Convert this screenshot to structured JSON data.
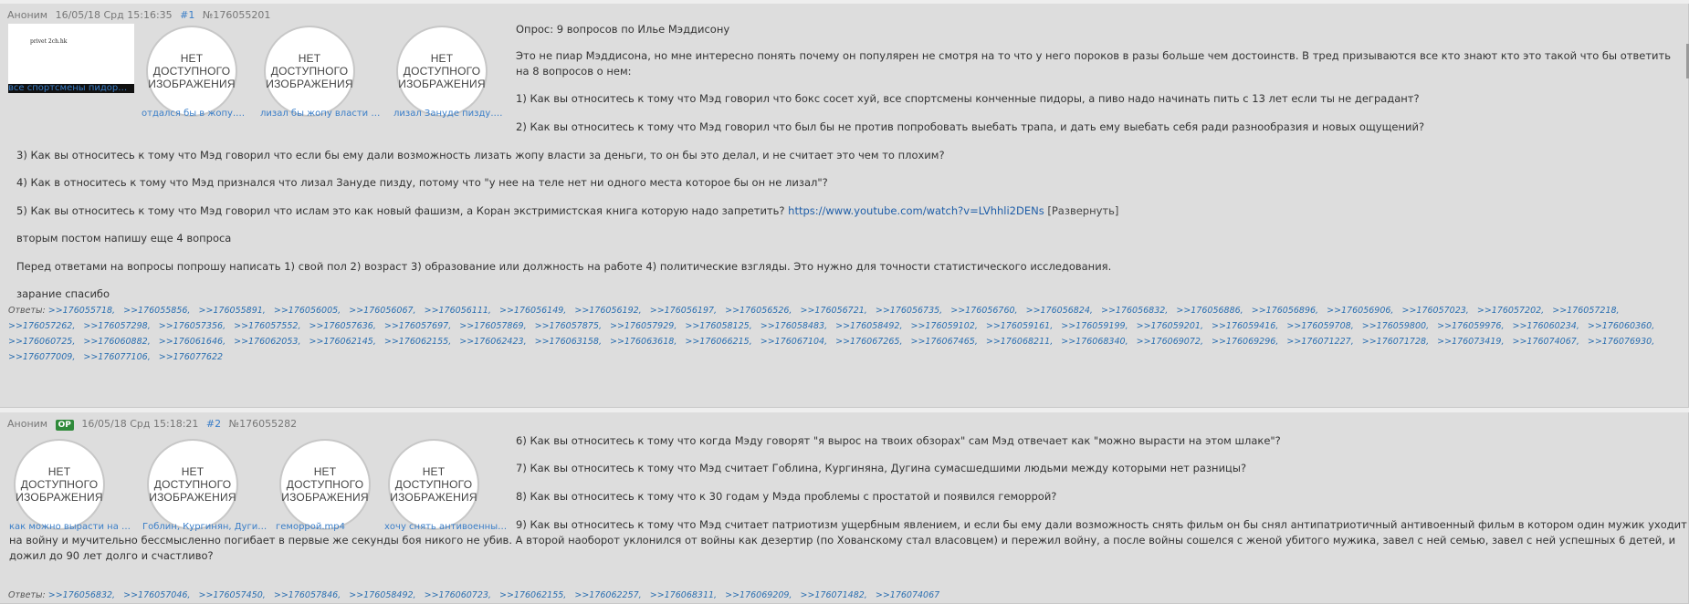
{
  "posts": [
    {
      "author": "Аноним",
      "datetime": "16/05/18 Срд 15:16:35",
      "index": "#1",
      "number": "№176055201",
      "thumb_caption": "privet 2ch.hk",
      "no_image_text": "НЕТ\nДОСТУПНОГО\nИЗОБРАЖЕНИЯ",
      "files": [
        "все спортсмены пидоры ...",
        "отдался бы в жопу.mp4",
        "лизал бы жопу власти за...",
        "лизал Зануде пизду.mp4"
      ],
      "paragraphs": [
        "Опрос: 9 вопросов по Илье Мэддисону",
        "Это не пиар Мэддисона, но мне интересно понять почему он популярен не смотря на то что у него пороков в разы больше чем достоинств. В тред призываются все кто знают кто это такой что бы ответить на 8 вопросов о нем:",
        "1) Как вы относитесь к тому что Мэд говорил что бокс сосет хуй, все спортсмены конченные пидоры, а пиво надо начинать пить с 13 лет если ты не деградант?",
        "2) Как вы относитесь к тому что Мэд говорил что был бы не против попробовать выебать трапа, и дать ему выебать себя ради разнообразия и новых ощущений?",
        "3) Как вы относитесь к тому что Мэд говорил что если бы ему дали возможность лизать жопу власти за деньги, то он бы это делал, и не считает это чем то плохим?",
        "4) Как в относитесь к тому что Мэд признался что лизал Зануде пизду, потому что \"у нее на теле нет ни одного места которое бы он не лизал\"?",
        "5) Как вы относитесь к тому что Мэд говорил что ислам это как новый фашизм, а Коран экстримистская книга которую надо запретить?",
        "вторым постом напишу еще 4 вопроса",
        "Перед ответами на вопросы попрошу написать 1) свой пол 2) возраст 3) образование или должность на работе 4) политические взгляды. Это нужно для точности статистического исследования.",
        "зарание спасибо"
      ],
      "link": "https://www.youtube.com/watch?v=LVhhli2DENs",
      "expand_label": "[Развернуть]",
      "replies_label": "Ответы:",
      "replies": [
        ">>176055718",
        ">>176055856",
        ">>176055891",
        ">>176056005",
        ">>176056067",
        ">>176056111",
        ">>176056149",
        ">>176056192",
        ">>176056197",
        ">>176056526",
        ">>176056721",
        ">>176056735",
        ">>176056760",
        ">>176056824",
        ">>176056832",
        ">>176056886",
        ">>176056896",
        ">>176056906",
        ">>176057023",
        ">>176057202",
        ">>176057218",
        ">>176057262",
        ">>176057298",
        ">>176057356",
        ">>176057552",
        ">>176057636",
        ">>176057697",
        ">>176057869",
        ">>176057875",
        ">>176057929",
        ">>176058125",
        ">>176058483",
        ">>176058492",
        ">>176059102",
        ">>176059161",
        ">>176059199",
        ">>176059201",
        ">>176059416",
        ">>176059708",
        ">>176059800",
        ">>176059976",
        ">>176060234",
        ">>176060360",
        ">>176060725",
        ">>176060882",
        ">>176061646",
        ">>176062053",
        ">>176062145",
        ">>176062155",
        ">>176062423",
        ">>176063158",
        ">>176063618",
        ">>176066215",
        ">>176067104",
        ">>176067265",
        ">>176067465",
        ">>176068211",
        ">>176068340",
        ">>176069072",
        ">>176069296",
        ">>176071227",
        ">>176071728",
        ">>176073419",
        ">>176074067",
        ">>176076930",
        ">>176077009",
        ">>176077106",
        ">>176077622"
      ]
    },
    {
      "author": "Аноним",
      "op_badge": "OP",
      "datetime": "16/05/18 Срд 15:18:21",
      "index": "#2",
      "number": "№176055282",
      "files": [
        "как можно вырасти на эт...",
        "Гоблин, Кургинян, Дугин...",
        "геморрой.mp4",
        "хочу снять антивоенный ..."
      ],
      "paragraphs": [
        "6) Как вы относитесь к тому что когда Мэду говорят \"я вырос на твоих обзорах\" сам Мэд отвечает как \"можно вырасти на этом шлаке\"?",
        "7) Как вы относитесь к тому что Мэд считает Гоблина, Кургиняна, Дугина сумасшедшими людьми между которыми нет разницы?",
        "8) Как вы относитесь к тому что к 30 годам у Мэда проблемы с простатой и появился геморрой?",
        "9) Как вы относитесь к тому что Мэд считает патриотизм ущербным явлением, и если бы ему дали возможность снять фильм он бы снял антипатриотичный антивоенный фильм в котором один мужик уходит на войну и мучительно бессмысленно погибает в первые же секунды боя никого не убив. А второй наоборот уклонился от войны как дезертир (по Хованскому стал власовцем) и пережил войну, а после войны сошелся с женой убитого мужика, завел с ней семью, завел с ней успешных 6 детей, и дожил до 90 лет долго и счастливо?"
      ],
      "replies_label": "Ответы:",
      "replies": [
        ">>176056832",
        ">>176057046",
        ">>176057450",
        ">>176057846",
        ">>176058492",
        ">>176060723",
        ">>176062155",
        ">>176062257",
        ">>176068311",
        ">>176069209",
        ">>176071482",
        ">>176074067"
      ]
    }
  ]
}
